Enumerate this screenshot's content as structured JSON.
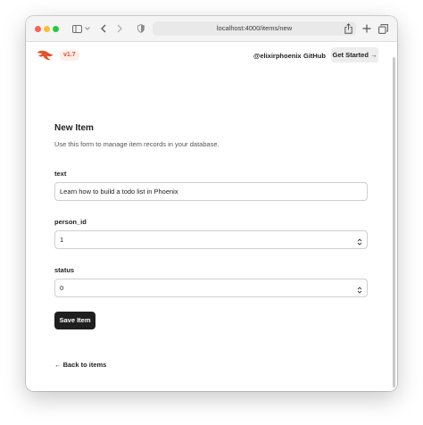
{
  "browser": {
    "url": "localhost:4000/items/new",
    "icons": [
      "sidebar-icon",
      "chevron-down-icon",
      "back-icon",
      "forward-icon",
      "shield-icon",
      "share-icon",
      "plus-icon",
      "tabs-icon"
    ]
  },
  "header": {
    "version": "v1.7",
    "links": [
      "@elixirphoenix",
      "GitHub"
    ],
    "cta": "Get Started →",
    "brand_color": "#e5512a"
  },
  "main": {
    "title": "New Item",
    "subtitle": "Use this form to manage item records in your database.",
    "fields": [
      {
        "label": "text",
        "value": "Learn how to build a todo list in Phoenix"
      },
      {
        "label": "person_id",
        "value": "1"
      },
      {
        "label": "status",
        "value": "0"
      }
    ],
    "save_label": "Save Item",
    "back_label": "← Back to items"
  }
}
